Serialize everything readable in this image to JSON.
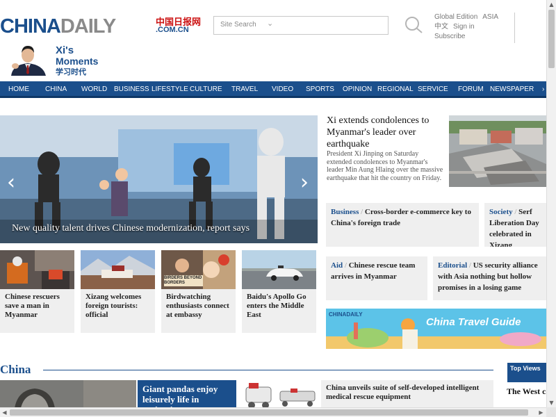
{
  "header": {
    "logo_china": "CHINA",
    "logo_daily": "DAILY",
    "logo_cn_chars": "中国日报网",
    "logo_domain": ".COM.CN",
    "search_placeholder": "Site Search",
    "links": [
      "Global Edition",
      "ASIA",
      "中文",
      "Sign in",
      "Subscribe"
    ]
  },
  "xi_banner": {
    "line1": "Xi's",
    "line2": "Moments",
    "line3": "学习时代"
  },
  "nav": {
    "items": [
      "HOME",
      "CHINA",
      "WORLD",
      "BUSINESS",
      "LIFESTYLE",
      "CULTURE",
      "TRAVEL",
      "VIDEO",
      "SPORTS",
      "OPINION",
      "REGIONAL",
      "SERVICE",
      "FORUM",
      "NEWSPAPER",
      "›"
    ]
  },
  "hero": {
    "caption": "New quality talent drives Chinese modernization, report says",
    "prev_icon": "‹",
    "next_icon": "›"
  },
  "top_story": {
    "title": "Xi extends condolences to Myanmar's leader over earthquake",
    "summary": "President Xi Jinping on Saturday extended condolences to Myanmar's leader Min Aung Hlaing over the massive earthquake that hit the country on Friday."
  },
  "cards": [
    {
      "tag": "Business",
      "text": "Cross-border e-commerce key to China's foreign trade"
    },
    {
      "tag": "Society",
      "text": "Serf Liberation Day celebrated in Xizang"
    },
    {
      "tag": "Aid",
      "text": "Chinese rescue team arrives in Myanmar"
    },
    {
      "tag": "Editorial",
      "text": "US security alliance with Asia nothing but hollow promises in a losing game"
    }
  ],
  "thumbs": [
    {
      "title": "Chinese rescuers save a man in Myanmar"
    },
    {
      "title": "Xizang welcomes foreign tourists: official"
    },
    {
      "title": "Birdwatching enthusiasts connect at embassy"
    },
    {
      "title": "Baidu's Apollo Go enters the Middle East"
    }
  ],
  "thumb_overlay": "BIRDERS BEYOND BORDERS",
  "ad": {
    "logo": "CHINADAILY",
    "title": "China Travel Guide"
  },
  "section": {
    "title": "China",
    "top_views_label": "Top Views",
    "top_views_first": "The West cannot do"
  },
  "china_stories": [
    {
      "title": "Giant pandas enjoy leisurely life in springtime"
    },
    {
      "title": "China unveils suite of self-developed intelligent medical rescue equipment"
    }
  ],
  "scroll_icons": {
    "up": "▲",
    "down": "▼",
    "left": "◀",
    "right": "▶"
  },
  "colors": {
    "brand_blue": "#1b4f8c",
    "card_bg": "#efefef",
    "nav_bg": "#1b4f8c"
  }
}
